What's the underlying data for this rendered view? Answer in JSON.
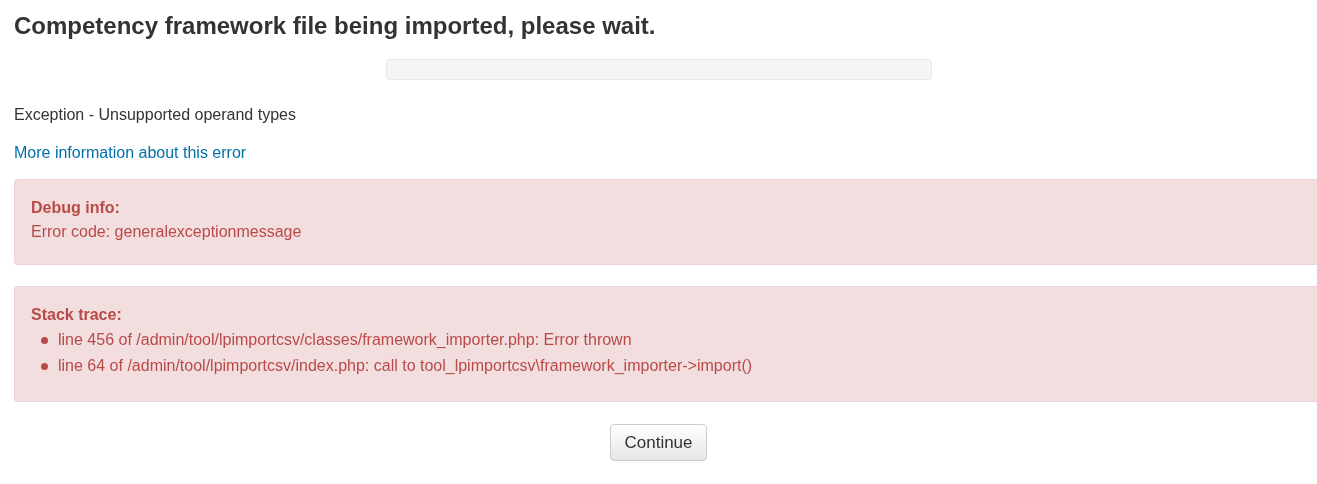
{
  "heading": "Competency framework file being imported, please wait.",
  "progress": {
    "level": 0
  },
  "message": "Exception - Unsupported operand types",
  "link": "More information about this error",
  "debug": {
    "title": "Debug info:",
    "text": "Error code: generalexceptionmessage"
  },
  "stack": {
    "title": "Stack trace:",
    "items": [
      "line 456 of /admin/tool/lpimportcsv/classes/framework_importer.php: Error thrown",
      "line 64 of /admin/tool/lpimportcsv/index.php: call to tool_lpimportcsv\\framework_importer->import()"
    ]
  },
  "button": "Continue"
}
